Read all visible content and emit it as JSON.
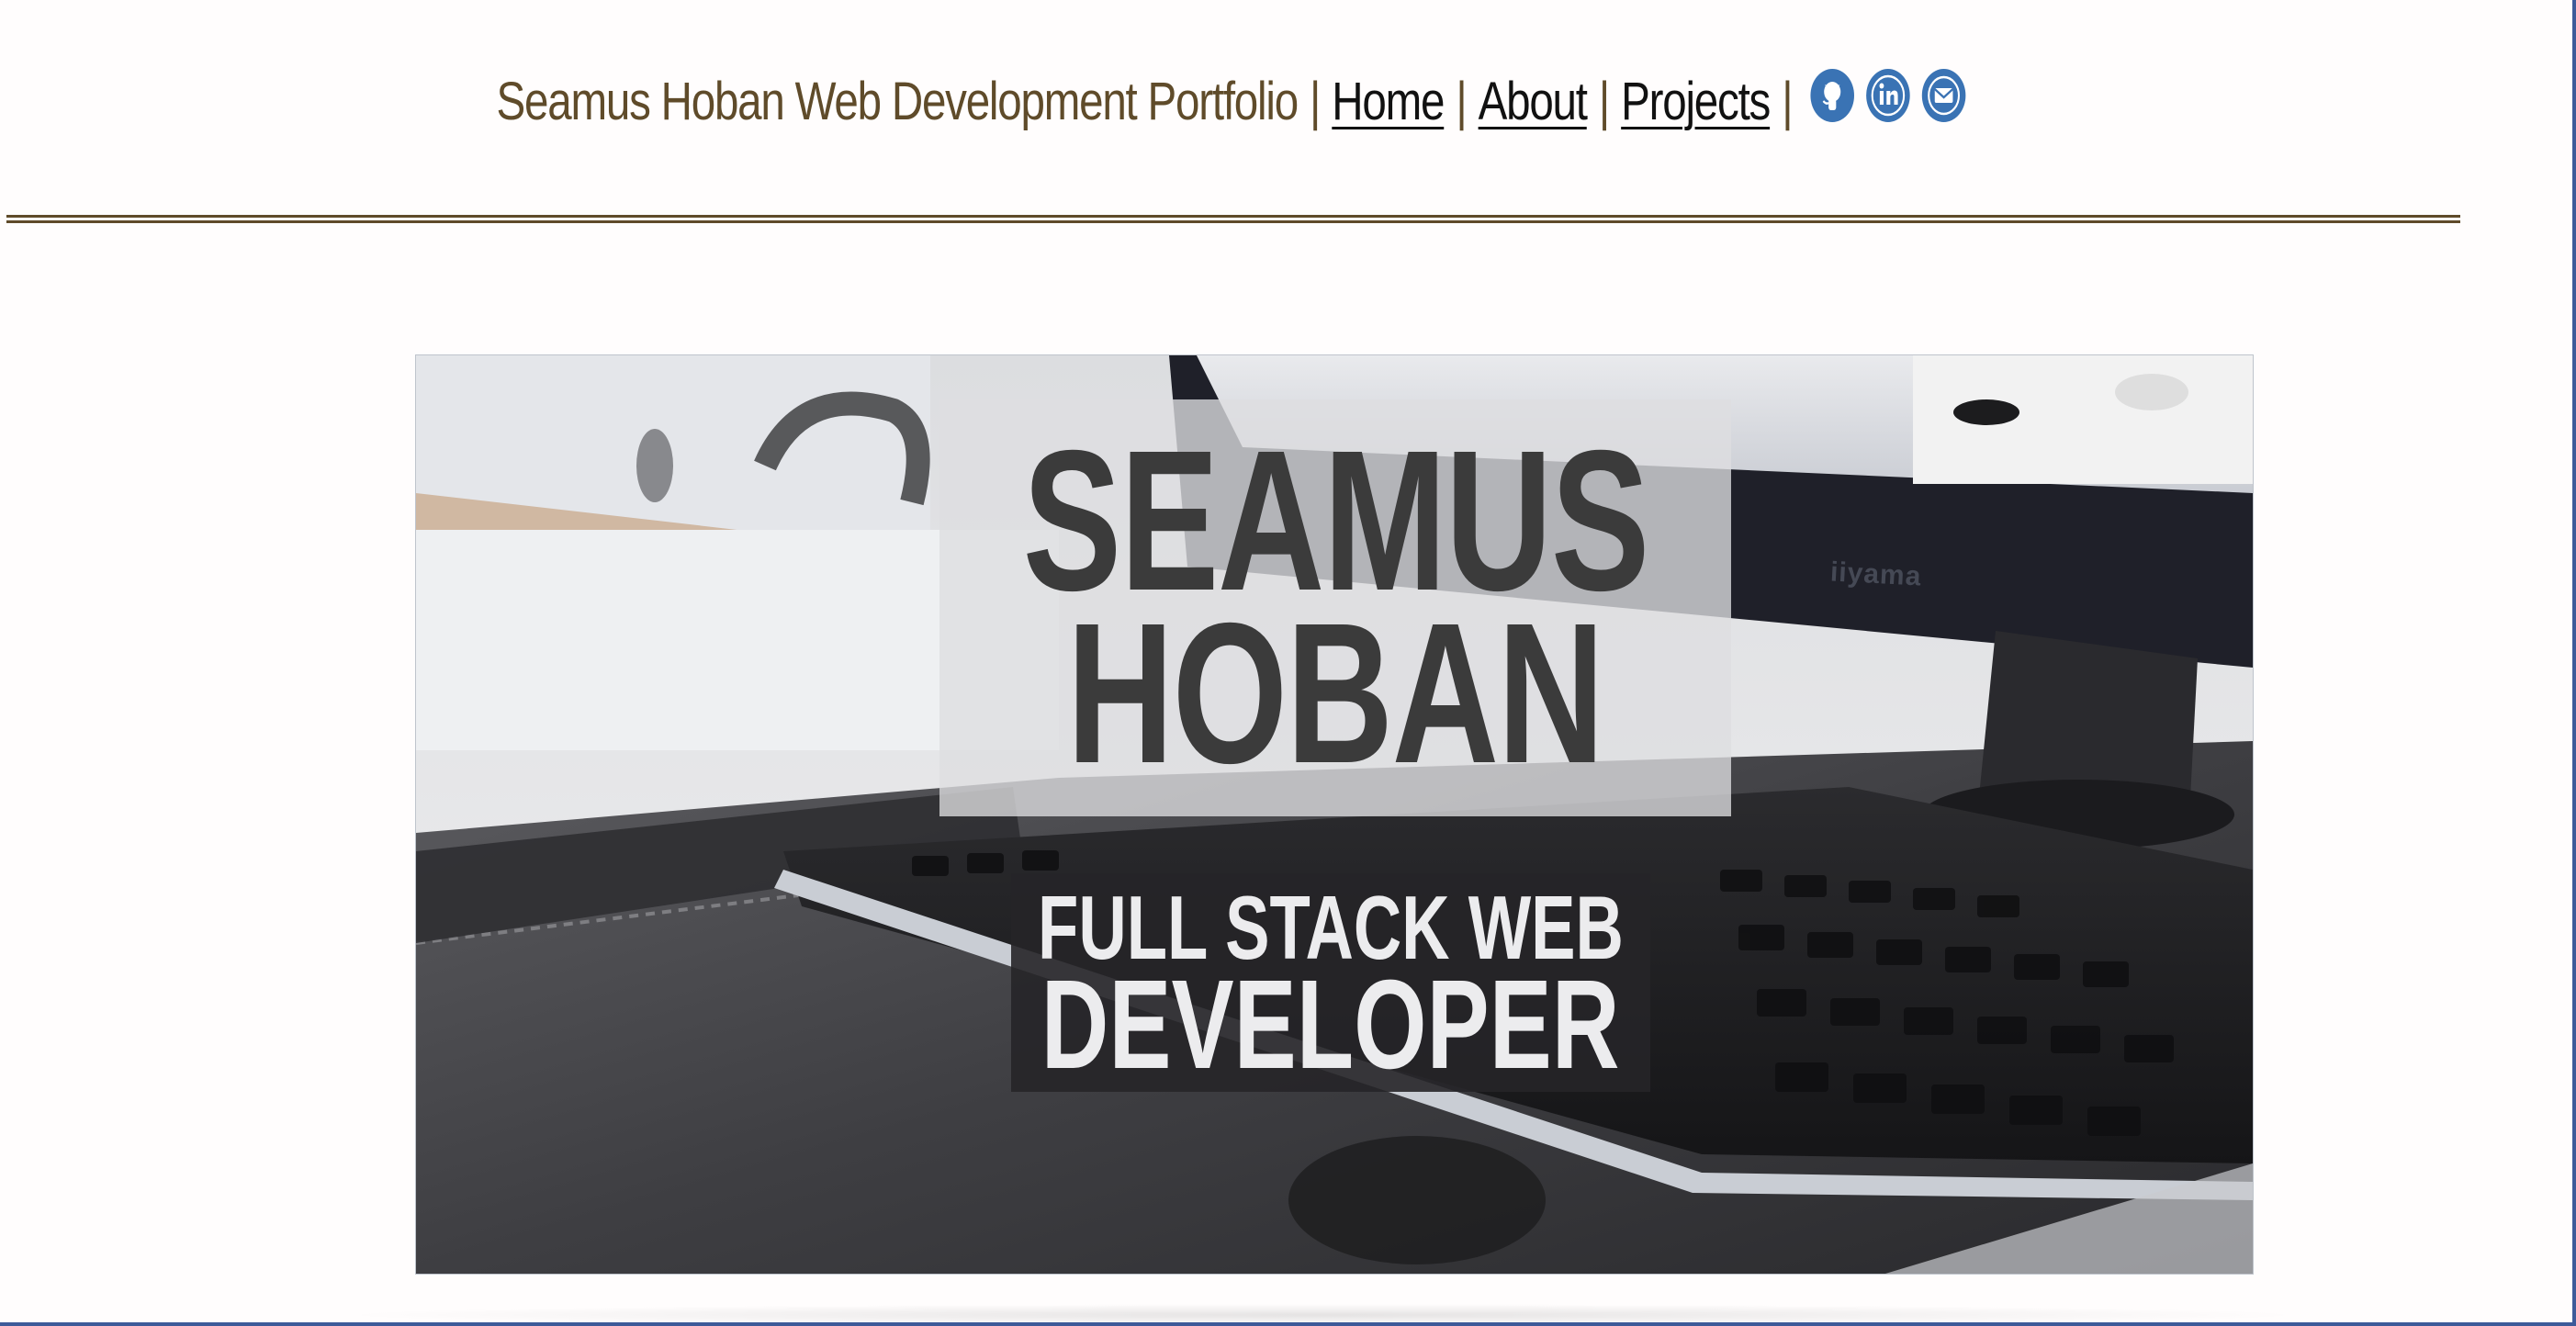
{
  "header": {
    "brand": "Seamus Hoban Web Development Portfolio",
    "separator": "|",
    "nav": [
      {
        "label": "Home"
      },
      {
        "label": "About"
      },
      {
        "label": "Projects"
      }
    ],
    "social": [
      {
        "icon": "github-icon"
      },
      {
        "icon": "linkedin-icon"
      },
      {
        "icon": "email-icon"
      }
    ]
  },
  "hero": {
    "name_line1": "SEAMUS",
    "name_line2": "HOBAN",
    "role_line1": "FULL STACK WEB",
    "role_line2": "DEVELOPER",
    "monitor_brand": "iiyama"
  },
  "colors": {
    "brand_text": "#5f4b2a",
    "link_text": "#111111",
    "social_button": "#3a73b4",
    "rule": "#5f4b2a",
    "name_text": "#3b3b3b",
    "role_bg": "#262528"
  }
}
